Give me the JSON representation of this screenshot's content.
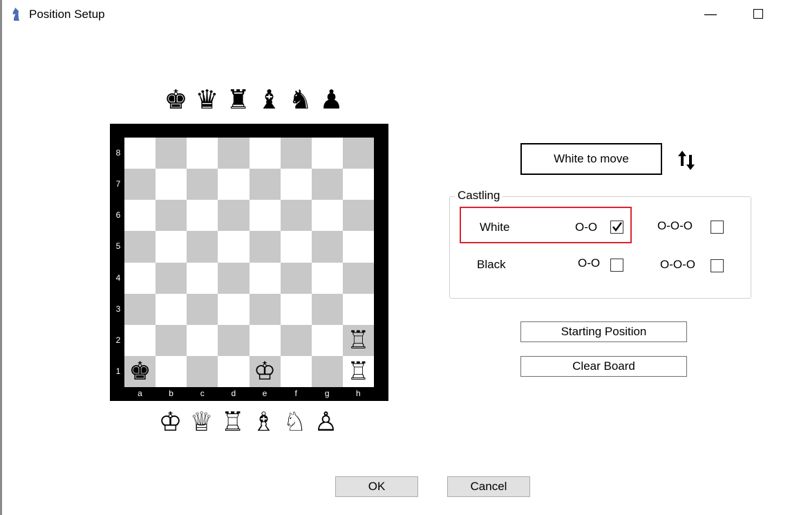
{
  "window": {
    "title": "Position Setup",
    "minimize_glyph": "—",
    "maximize_glyph": "☐",
    "icon": "chess-knight-app-icon"
  },
  "palette_black": [
    {
      "name": "black-king",
      "glyph": "♚"
    },
    {
      "name": "black-queen",
      "glyph": "♛"
    },
    {
      "name": "black-rook",
      "glyph": "♜"
    },
    {
      "name": "black-bishop",
      "glyph": "♝"
    },
    {
      "name": "black-knight",
      "glyph": "♞"
    },
    {
      "name": "black-pawn",
      "glyph": "♟"
    }
  ],
  "palette_white": [
    {
      "name": "white-king",
      "glyph": "♔"
    },
    {
      "name": "white-queen",
      "glyph": "♕"
    },
    {
      "name": "white-rook",
      "glyph": "♖"
    },
    {
      "name": "white-bishop",
      "glyph": "♗"
    },
    {
      "name": "white-knight",
      "glyph": "♘"
    },
    {
      "name": "white-pawn",
      "glyph": "♙"
    }
  ],
  "board": {
    "ranks": [
      "8",
      "7",
      "6",
      "5",
      "4",
      "3",
      "2",
      "1"
    ],
    "files": [
      "a",
      "b",
      "c",
      "d",
      "e",
      "f",
      "g",
      "h"
    ],
    "pieces": [
      {
        "square": "h2",
        "glyph": "♖",
        "name": "white-rook"
      },
      {
        "square": "a1",
        "glyph": "♚",
        "name": "black-king"
      },
      {
        "square": "e1",
        "glyph": "♔",
        "name": "white-king"
      },
      {
        "square": "h1",
        "glyph": "♖",
        "name": "white-rook"
      }
    ],
    "light_color": "#ffffff",
    "dark_color": "#c8c8c8"
  },
  "side_to_move": {
    "label": "White to move",
    "swap_icon": "swap-arrows-icon"
  },
  "castling": {
    "legend": "Castling",
    "white": {
      "label": "White",
      "kingside_label": "O-O",
      "kingside_checked": true,
      "queenside_label": "O-O-O",
      "queenside_checked": false
    },
    "black": {
      "label": "Black",
      "kingside_label": "O-O",
      "kingside_checked": false,
      "queenside_label": "O-O-O",
      "queenside_checked": false
    },
    "highlight_color": "#d9262f"
  },
  "buttons": {
    "starting_position": "Starting Position",
    "clear_board": "Clear Board",
    "ok": "OK",
    "cancel": "Cancel"
  }
}
